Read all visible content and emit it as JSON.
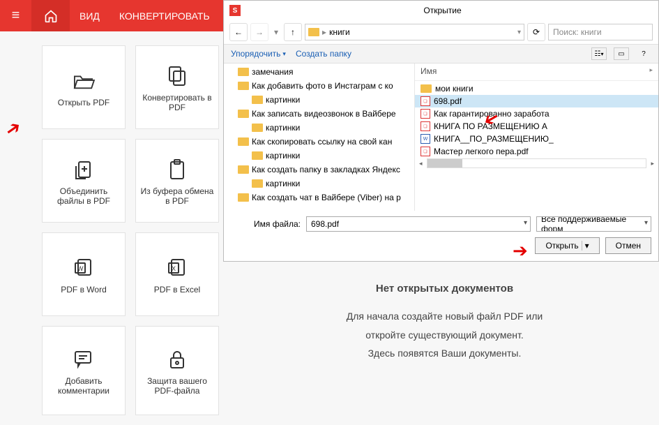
{
  "header": {
    "tab_view": "ВИД",
    "tab_convert": "КОНВЕРТИРОВАТЬ"
  },
  "tiles": [
    {
      "id": "open",
      "label": "Открыть PDF"
    },
    {
      "id": "convert",
      "label": "Конвертировать в PDF"
    },
    {
      "id": "merge",
      "label": "Объединить файлы в PDF"
    },
    {
      "id": "clipboard",
      "label": "Из буфера обмена в PDF"
    },
    {
      "id": "toword",
      "label": "PDF в Word"
    },
    {
      "id": "toexcel",
      "label": "PDF в Excel"
    },
    {
      "id": "comments",
      "label": "Добавить комментарии"
    },
    {
      "id": "protect",
      "label": "Защита вашего PDF-файла"
    }
  ],
  "empty": {
    "title": "Нет открытых документов",
    "line1": "Для начала создайте новый файл PDF или",
    "line2": "откройте существующий документ.",
    "line3": "Здесь появятся Ваши документы."
  },
  "dialog": {
    "title": "Открытие",
    "breadcrumb": "книги",
    "search_placeholder": "Поиск: книги",
    "toolbar_organize": "Упорядочить",
    "toolbar_newfolder": "Создать папку",
    "list_header": "Имя",
    "tree": [
      {
        "label": "замечания",
        "sub": false
      },
      {
        "label": "Как добавить фото в Инстаграм с ко",
        "sub": false
      },
      {
        "label": "картинки",
        "sub": true
      },
      {
        "label": "Как записать видеозвонок в Вайбере",
        "sub": false
      },
      {
        "label": "картинки",
        "sub": true
      },
      {
        "label": "Как скопировать ссылку на свой кан",
        "sub": false
      },
      {
        "label": "картинки",
        "sub": true
      },
      {
        "label": "Как создать папку в закладках Яндекс",
        "sub": false
      },
      {
        "label": "картинки",
        "sub": true
      },
      {
        "label": "Как создать чат в Вайбере (Viber) на р",
        "sub": false
      }
    ],
    "files": [
      {
        "name": "мои книги",
        "type": "folder"
      },
      {
        "name": "698.pdf",
        "type": "pdf",
        "selected": true
      },
      {
        "name": "Как гарантированно заработа",
        "type": "pdf"
      },
      {
        "name": "КНИГА  ПО РАЗМЕЩЕНИЮ А",
        "type": "pdf"
      },
      {
        "name": "КНИГА__ПО_РАЗМЕЩЕНИЮ_",
        "type": "word"
      },
      {
        "name": "Мастер легкого пера.pdf",
        "type": "pdf"
      }
    ],
    "filename_label": "Имя файла:",
    "filename_value": "698.pdf",
    "filter": "Все поддерживаемые форм",
    "btn_open": "Открыть",
    "btn_cancel": "Отмен"
  }
}
